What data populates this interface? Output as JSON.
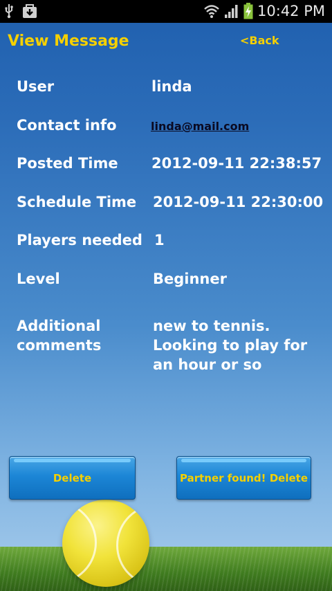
{
  "status_bar": {
    "time": "10:42 PM",
    "icons": [
      "usb-icon",
      "download-icon",
      "wifi-icon",
      "signal-icon",
      "battery-charging-icon"
    ]
  },
  "header": {
    "title": "View Message",
    "back_label": "<Back"
  },
  "details": {
    "user_label": "User",
    "user_value": "linda",
    "contact_label": "Contact info",
    "contact_value": "linda@mail.com",
    "posted_label": "Posted Time",
    "posted_value": "2012-09-11 22:38:57",
    "schedule_label": "Schedule Time",
    "schedule_value": "2012-09-11 22:30:00",
    "players_label": "Players needed",
    "players_value": "1",
    "level_label": "Level",
    "level_value": "Beginner",
    "comments_label": "Additional comments",
    "comments_value": "new to tennis. Looking to play for an hour or so"
  },
  "actions": {
    "delete_label": "Delete",
    "partner_found_label": "Partner found! Delete"
  },
  "colors": {
    "accent": "#f5d000",
    "background_top": "#1f5fae",
    "background_bottom": "#a9cdec",
    "button": "#1c86d6"
  }
}
